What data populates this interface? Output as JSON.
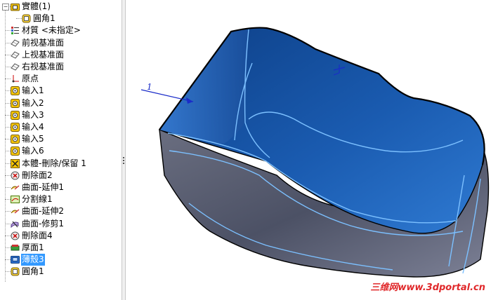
{
  "tree": {
    "items": [
      {
        "label": "實體(1)",
        "icon": "solid-bodies-folder-icon",
        "indent": 0,
        "selected": false
      },
      {
        "label": "圓角1",
        "icon": "fillet-icon",
        "indent": 1,
        "selected": false
      },
      {
        "label": "材質 <未指定>",
        "icon": "material-icon",
        "indent": 0,
        "selected": false
      },
      {
        "label": "前视基准面",
        "icon": "plane-icon",
        "indent": 0,
        "selected": false
      },
      {
        "label": "上视基准面",
        "icon": "plane-icon",
        "indent": 0,
        "selected": false
      },
      {
        "label": "右视基准面",
        "icon": "plane-icon",
        "indent": 0,
        "selected": false
      },
      {
        "label": "原点",
        "icon": "origin-icon",
        "indent": 0,
        "selected": false
      },
      {
        "label": "输入1",
        "icon": "import-icon",
        "indent": 0,
        "selected": false
      },
      {
        "label": "输入2",
        "icon": "import-icon",
        "indent": 0,
        "selected": false
      },
      {
        "label": "输入3",
        "icon": "import-icon",
        "indent": 0,
        "selected": false
      },
      {
        "label": "输入4",
        "icon": "import-icon",
        "indent": 0,
        "selected": false
      },
      {
        "label": "输入5",
        "icon": "import-icon",
        "indent": 0,
        "selected": false
      },
      {
        "label": "输入6",
        "icon": "import-icon",
        "indent": 0,
        "selected": false
      },
      {
        "label": "本體-刪除/保留 1",
        "icon": "body-delete-icon",
        "indent": 0,
        "selected": false
      },
      {
        "label": "刪除面2",
        "icon": "delete-face-icon",
        "indent": 0,
        "selected": false
      },
      {
        "label": "曲面-延伸1",
        "icon": "surface-extend-icon",
        "indent": 0,
        "selected": false
      },
      {
        "label": "分割線1",
        "icon": "split-line-icon",
        "indent": 0,
        "selected": false
      },
      {
        "label": "曲面-延伸2",
        "icon": "surface-extend-icon",
        "indent": 0,
        "selected": false
      },
      {
        "label": "曲面-修剪1",
        "icon": "surface-trim-icon",
        "indent": 0,
        "selected": false
      },
      {
        "label": "刪除面4",
        "icon": "delete-face-icon",
        "indent": 0,
        "selected": false
      },
      {
        "label": "厚面1",
        "icon": "thicken-icon",
        "indent": 0,
        "selected": false
      },
      {
        "label": "薄殼3",
        "icon": "shell-icon",
        "indent": 0,
        "selected": true
      },
      {
        "label": "圓角1",
        "icon": "fillet-icon",
        "indent": 0,
        "selected": false
      }
    ]
  },
  "viewport": {
    "triad_label": "1"
  },
  "watermark": "三维网www.3dportal.cn",
  "colors": {
    "selection": "#3399ff",
    "shell_inner": "#1f5fb4",
    "shell_outer": "#4a4f63",
    "edge": "#6fb6ff",
    "watermark": "#e0282a"
  }
}
